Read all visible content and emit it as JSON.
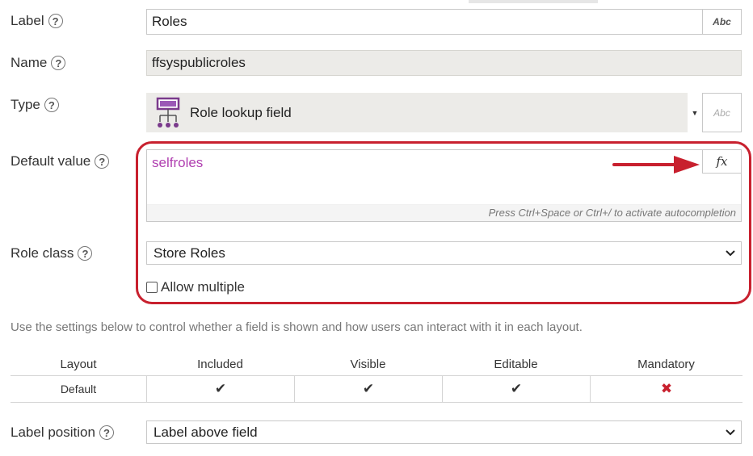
{
  "label_field": {
    "label": "Label",
    "value": "Roles",
    "type_btn": "Abc"
  },
  "name_field": {
    "label": "Name",
    "value": "ffsyspublicroles"
  },
  "type_field": {
    "label": "Type",
    "value": "Role lookup field",
    "type_btn": "Abc",
    "icon": "role-lookup-icon"
  },
  "default_value": {
    "label": "Default value",
    "value": "selfroles",
    "hint": "Press Ctrl+Space or Ctrl+/ to activate autocompletion",
    "fx_label": "fx"
  },
  "role_class": {
    "label": "Role class",
    "value": "Store Roles"
  },
  "allow_multiple": {
    "label": "Allow multiple",
    "checked": false
  },
  "help_symbol": "?",
  "layout_info": "Use the settings below to control whether a field is shown and how users can interact with it in each layout.",
  "layout_table": {
    "headers": [
      "Layout",
      "Included",
      "Visible",
      "Editable",
      "Mandatory"
    ],
    "rows": [
      {
        "layout": "Default",
        "included": "✔",
        "visible": "✔",
        "editable": "✔",
        "mandatory": "✖"
      }
    ]
  },
  "label_position": {
    "label": "Label position",
    "value": "Label above field"
  },
  "colors": {
    "highlight": "#c8202e",
    "expression": "#b03fb0",
    "mandatory_x": "#c8202e",
    "type_icon": "#7a3a8c"
  }
}
